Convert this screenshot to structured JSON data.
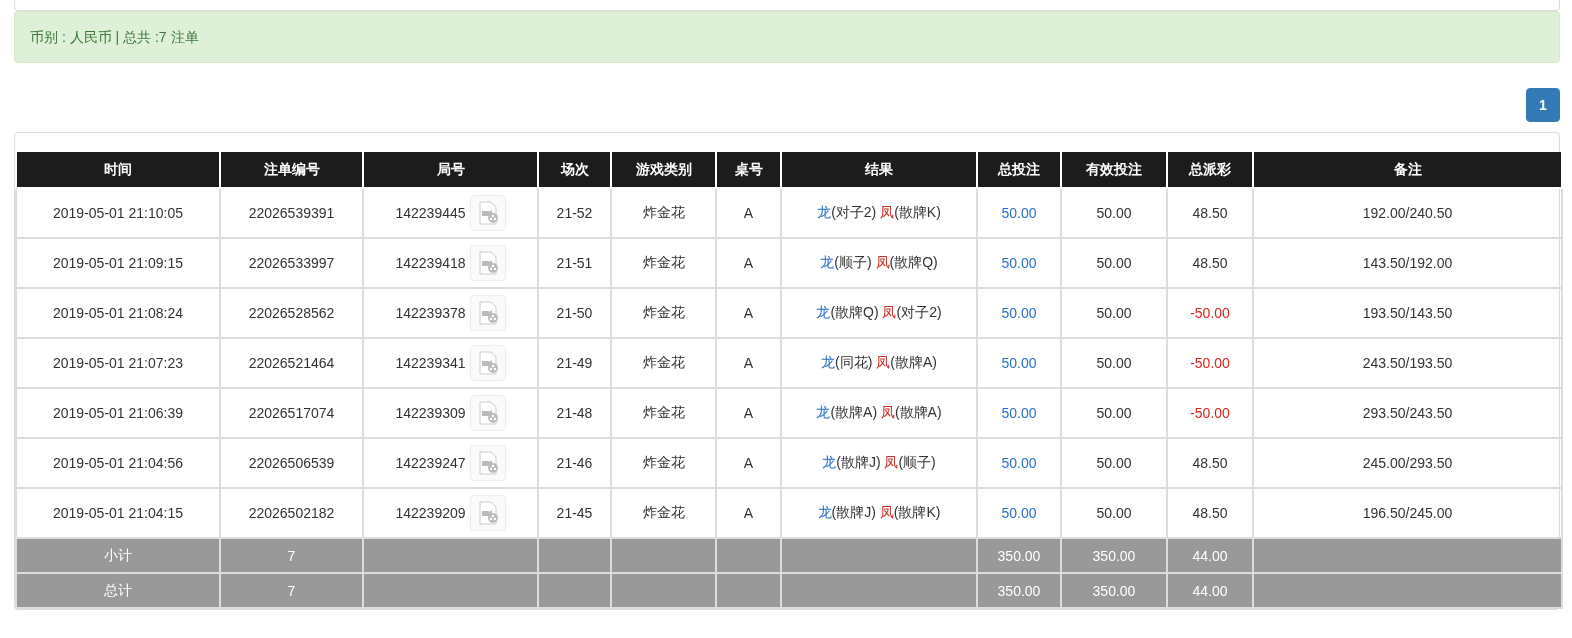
{
  "summary": {
    "text": "币别 : 人民币 | 总共 :7 注单"
  },
  "pagination": [
    {
      "label": "1",
      "selected": true
    }
  ],
  "table": {
    "columns": [
      "时间",
      "注单编号",
      "局号",
      "场次",
      "游戏类别",
      "桌号",
      "结果",
      "总投注",
      "有效投注",
      "总派彩",
      "备注"
    ],
    "rows": [
      {
        "time": "2019-05-01 21:10:05",
        "bet_id": "22026539391",
        "round": "142239445",
        "session": "21-52",
        "game": "炸金花",
        "table": "A",
        "dragon": "龙",
        "dragon_hand": "(对子2)",
        "phoenix": "凤",
        "phoenix_hand": "(散牌K)",
        "total_bet": "50.00",
        "valid_bet": "50.00",
        "payout": "48.50",
        "negative": false,
        "note": "192.00/240.50"
      },
      {
        "time": "2019-05-01 21:09:15",
        "bet_id": "22026533997",
        "round": "142239418",
        "session": "21-51",
        "game": "炸金花",
        "table": "A",
        "dragon": "龙",
        "dragon_hand": "(顺子)",
        "phoenix": "凤",
        "phoenix_hand": "(散牌Q)",
        "total_bet": "50.00",
        "valid_bet": "50.00",
        "payout": "48.50",
        "negative": false,
        "note": "143.50/192.00"
      },
      {
        "time": "2019-05-01 21:08:24",
        "bet_id": "22026528562",
        "round": "142239378",
        "session": "21-50",
        "game": "炸金花",
        "table": "A",
        "dragon": "龙",
        "dragon_hand": "(散牌Q)",
        "phoenix": "凤",
        "phoenix_hand": "(对子2)",
        "total_bet": "50.00",
        "valid_bet": "50.00",
        "payout": "-50.00",
        "negative": true,
        "note": "193.50/143.50"
      },
      {
        "time": "2019-05-01 21:07:23",
        "bet_id": "22026521464",
        "round": "142239341",
        "session": "21-49",
        "game": "炸金花",
        "table": "A",
        "dragon": "龙",
        "dragon_hand": "(同花)",
        "phoenix": "凤",
        "phoenix_hand": "(散牌A)",
        "total_bet": "50.00",
        "valid_bet": "50.00",
        "payout": "-50.00",
        "negative": true,
        "note": "243.50/193.50"
      },
      {
        "time": "2019-05-01 21:06:39",
        "bet_id": "22026517074",
        "round": "142239309",
        "session": "21-48",
        "game": "炸金花",
        "table": "A",
        "dragon": "龙",
        "dragon_hand": "(散牌A)",
        "phoenix": "凤",
        "phoenix_hand": "(散牌A)",
        "total_bet": "50.00",
        "valid_bet": "50.00",
        "payout": "-50.00",
        "negative": true,
        "note": "293.50/243.50"
      },
      {
        "time": "2019-05-01 21:04:56",
        "bet_id": "22026506539",
        "round": "142239247",
        "session": "21-46",
        "game": "炸金花",
        "table": "A",
        "dragon": "龙",
        "dragon_hand": "(散牌J)",
        "phoenix": "凤",
        "phoenix_hand": "(顺子)",
        "total_bet": "50.00",
        "valid_bet": "50.00",
        "payout": "48.50",
        "negative": false,
        "note": "245.00/293.50"
      },
      {
        "time": "2019-05-01 21:04:15",
        "bet_id": "22026502182",
        "round": "142239209",
        "session": "21-45",
        "game": "炸金花",
        "table": "A",
        "dragon": "龙",
        "dragon_hand": "(散牌J)",
        "phoenix": "凤",
        "phoenix_hand": "(散牌K)",
        "total_bet": "50.00",
        "valid_bet": "50.00",
        "payout": "48.50",
        "negative": false,
        "note": "196.50/245.00"
      }
    ],
    "totals": [
      {
        "label": "小计",
        "count": "7",
        "total_bet": "350.00",
        "valid_bet": "350.00",
        "payout": "44.00"
      },
      {
        "label": "总计",
        "count": "7",
        "total_bet": "350.00",
        "valid_bet": "350.00",
        "payout": "44.00"
      }
    ]
  }
}
